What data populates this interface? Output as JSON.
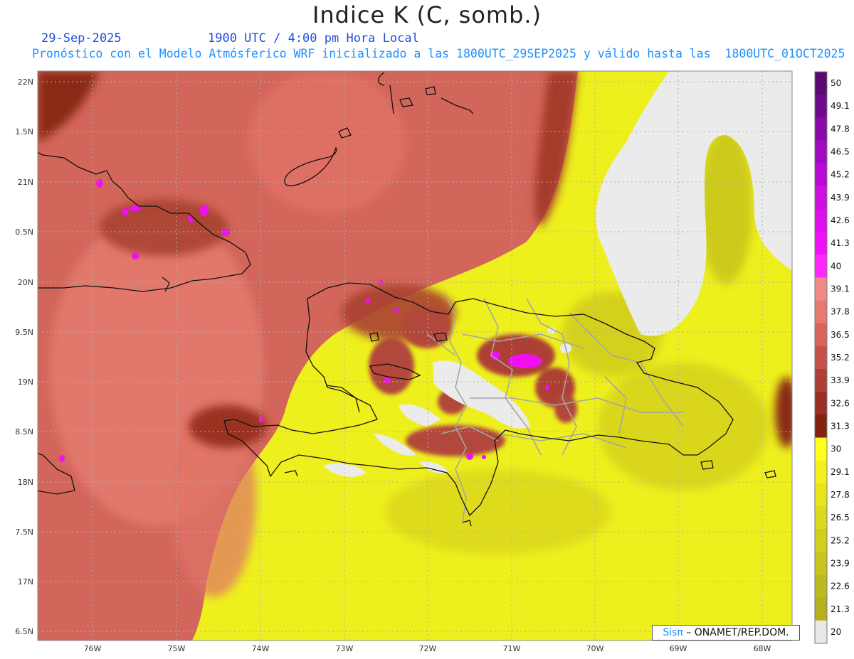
{
  "header": {
    "title": "Indice K (C, somb.)",
    "date": "29-Sep-2025",
    "time": "1900 UTC / 4:00 pm Hora Local",
    "subtitle": "Pronóstico con el Modelo Atmósferico WRF inicializado a las 1800UTC_29SEP2025 y válido hasta las  1800UTC_01OCT2025"
  },
  "credit": {
    "brand": "Sisπ",
    "org": " – ONAMET/REP.DOM."
  },
  "map": {
    "lon_labels": [
      "76W",
      "75W",
      "74W",
      "73W",
      "72W",
      "71W",
      "70W",
      "69W",
      "68W"
    ],
    "lat_labels": [
      "22N",
      "1.5N",
      "21N",
      "0.5N",
      "20N",
      "9.5N",
      "19N",
      "8.5N",
      "18N",
      "7.5N",
      "17N",
      "6.5N"
    ]
  },
  "colorbar": {
    "labels": [
      "50",
      "49.1",
      "47.8",
      "46.5",
      "45.2",
      "43.9",
      "42.6",
      "41.3",
      "40",
      "39.1",
      "37.8",
      "36.5",
      "35.2",
      "33.9",
      "32.6",
      "31.3",
      "30",
      "29.1",
      "27.8",
      "26.5",
      "25.2",
      "23.9",
      "22.6",
      "21.3",
      "20"
    ],
    "colors": [
      "#5a0a6e",
      "#6e0a8a",
      "#8a0aa8",
      "#a00ac0",
      "#b80ad2",
      "#cc10e0",
      "#dd10ec",
      "#f010f8",
      "#ff28ff",
      "#f08a86",
      "#e67a70",
      "#d8645c",
      "#c4524a",
      "#ae3f36",
      "#982e24",
      "#82220f",
      "#ffff1e",
      "#f3f01e",
      "#e8e41c",
      "#dcda1c",
      "#d0ce1e",
      "#c8c41e",
      "#bcba1e",
      "#b4b01e",
      "#e8e8e8"
    ],
    "colors_meaning": "bands from 50 (top) down to 20 and below (bottom)"
  }
}
